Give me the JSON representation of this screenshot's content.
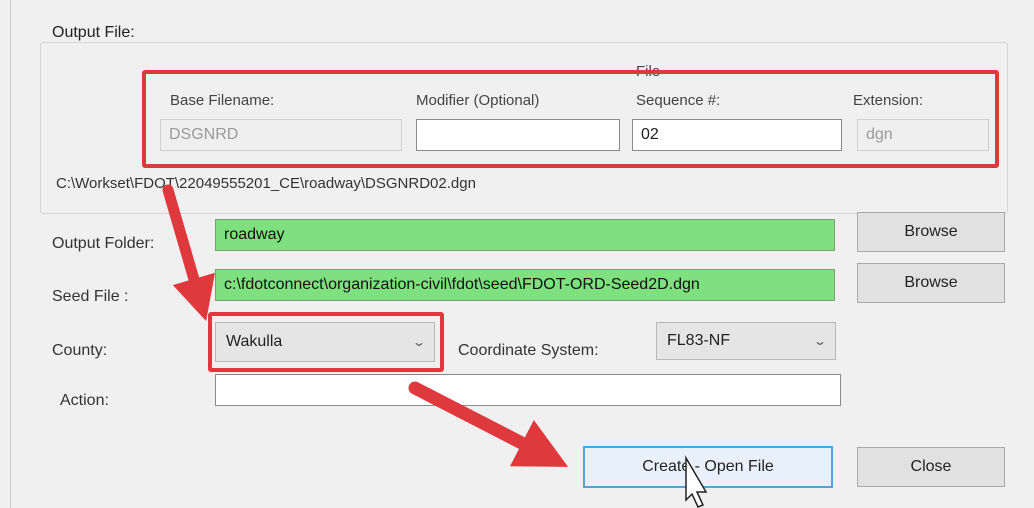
{
  "output_file": {
    "legend": "Output File:",
    "base_filename": {
      "label": "Base Filename:",
      "value": "DSGNRD"
    },
    "modifier": {
      "label": "Modifier (Optional)",
      "value": ""
    },
    "sequence": {
      "label_line1": "File",
      "label_line2": "Sequence #:",
      "value": "02"
    },
    "extension": {
      "label": "Extension:",
      "value": "dgn"
    },
    "full_path": "C:\\Workset\\FDOT\\22049555201_CE\\roadway\\DSGNRD02.dgn"
  },
  "output_folder": {
    "label": "Output Folder:",
    "value": "roadway",
    "browse_label": "Browse"
  },
  "seed_file": {
    "label": "Seed File :",
    "value": "c:\\fdotconnect\\organization-civil\\fdot\\seed\\FDOT-ORD-Seed2D.dgn",
    "browse_label": "Browse"
  },
  "county": {
    "label": "County:",
    "value": "Wakulla"
  },
  "coordinate_system": {
    "label": "Coordinate System:",
    "value": "FL83-NF"
  },
  "action": {
    "label": "Action:",
    "value": ""
  },
  "buttons": {
    "create_open": "Create - Open File",
    "close": "Close"
  },
  "colors": {
    "highlight_red": "#e0393d",
    "green_field": "#7ee07e",
    "primary_border": "#5aa0dc"
  }
}
